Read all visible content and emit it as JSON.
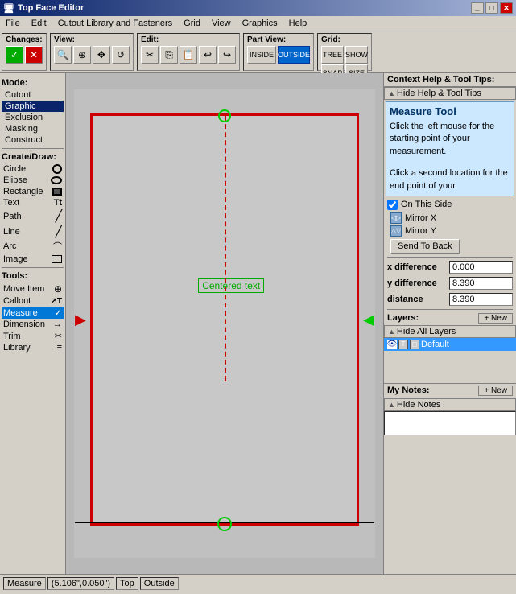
{
  "titlebar": {
    "title": "Top Face Editor",
    "buttons": [
      "_",
      "□",
      "✕"
    ]
  },
  "menubar": {
    "items": [
      "File",
      "Edit",
      "Cutout Library and Fasteners",
      "Grid",
      "View",
      "Graphics",
      "Help"
    ]
  },
  "toolbar": {
    "changes_label": "Changes:",
    "view_label": "View:",
    "edit_label": "Edit:",
    "part_view_label": "Part View:",
    "grid_label": "Grid:",
    "inside_label": "INSIDE",
    "outside_label": "OUTSIDE",
    "tree_label": "TREE",
    "show_label": "SHOW",
    "snap_label": "SNAP",
    "size_label": "SIZE"
  },
  "mode": {
    "label": "Mode:",
    "items": [
      "Cutout",
      "Graphic",
      "Exclusion",
      "Masking",
      "Construct"
    ]
  },
  "create_draw": {
    "label": "Create/Draw:",
    "items": [
      {
        "name": "Circle",
        "icon": "○"
      },
      {
        "name": "Elipse",
        "icon": "○"
      },
      {
        "name": "Rectangle",
        "icon": "□"
      },
      {
        "name": "Text",
        "icon": "T"
      },
      {
        "name": "Path",
        "icon": "/"
      },
      {
        "name": "Line",
        "icon": "/"
      },
      {
        "name": "Arc",
        "icon": "⌒"
      },
      {
        "name": "Image",
        "icon": "▭"
      }
    ]
  },
  "tools": {
    "label": "Tools:",
    "items": [
      {
        "name": "Move Item",
        "icon": "⊕"
      },
      {
        "name": "Callout",
        "icon": "T"
      },
      {
        "name": "Measure",
        "icon": "✓",
        "active": true
      },
      {
        "name": "Dimension",
        "icon": "↔"
      },
      {
        "name": "Trim",
        "icon": "✂"
      },
      {
        "name": "Library",
        "icon": "≡"
      }
    ]
  },
  "canvas": {
    "centered_text": "Centered text"
  },
  "context_help": {
    "header": "Context Help & Tool Tips:",
    "hide_label": "Hide Help & Tool Tips",
    "tool_title": "Measure Tool",
    "help_text_1": "Click the left mouse for the starting point of your measurement.",
    "help_text_2": "Click a second location for the end point of your"
  },
  "side_panel": {
    "on_this_side_label": "On This Side",
    "mirror_x_label": "Mirror X",
    "mirror_y_label": "Mirror Y",
    "send_to_back_label": "Send To Back",
    "x_difference_label": "x difference",
    "x_difference_value": "0.000",
    "y_difference_label": "y difference",
    "y_difference_value": "8.390",
    "distance_label": "distance",
    "distance_value": "8.390"
  },
  "layers": {
    "label": "Layers:",
    "new_label": "+ New",
    "hide_all_label": "Hide All Layers",
    "default_layer": "Default"
  },
  "notes": {
    "label": "My Notes:",
    "new_label": "+ New",
    "hide_label": "Hide Notes"
  },
  "statusbar": {
    "measure_label": "Measure",
    "coordinates": "(5.106\",0.050\")",
    "top_label": "Top",
    "outside_label": "Outside"
  }
}
